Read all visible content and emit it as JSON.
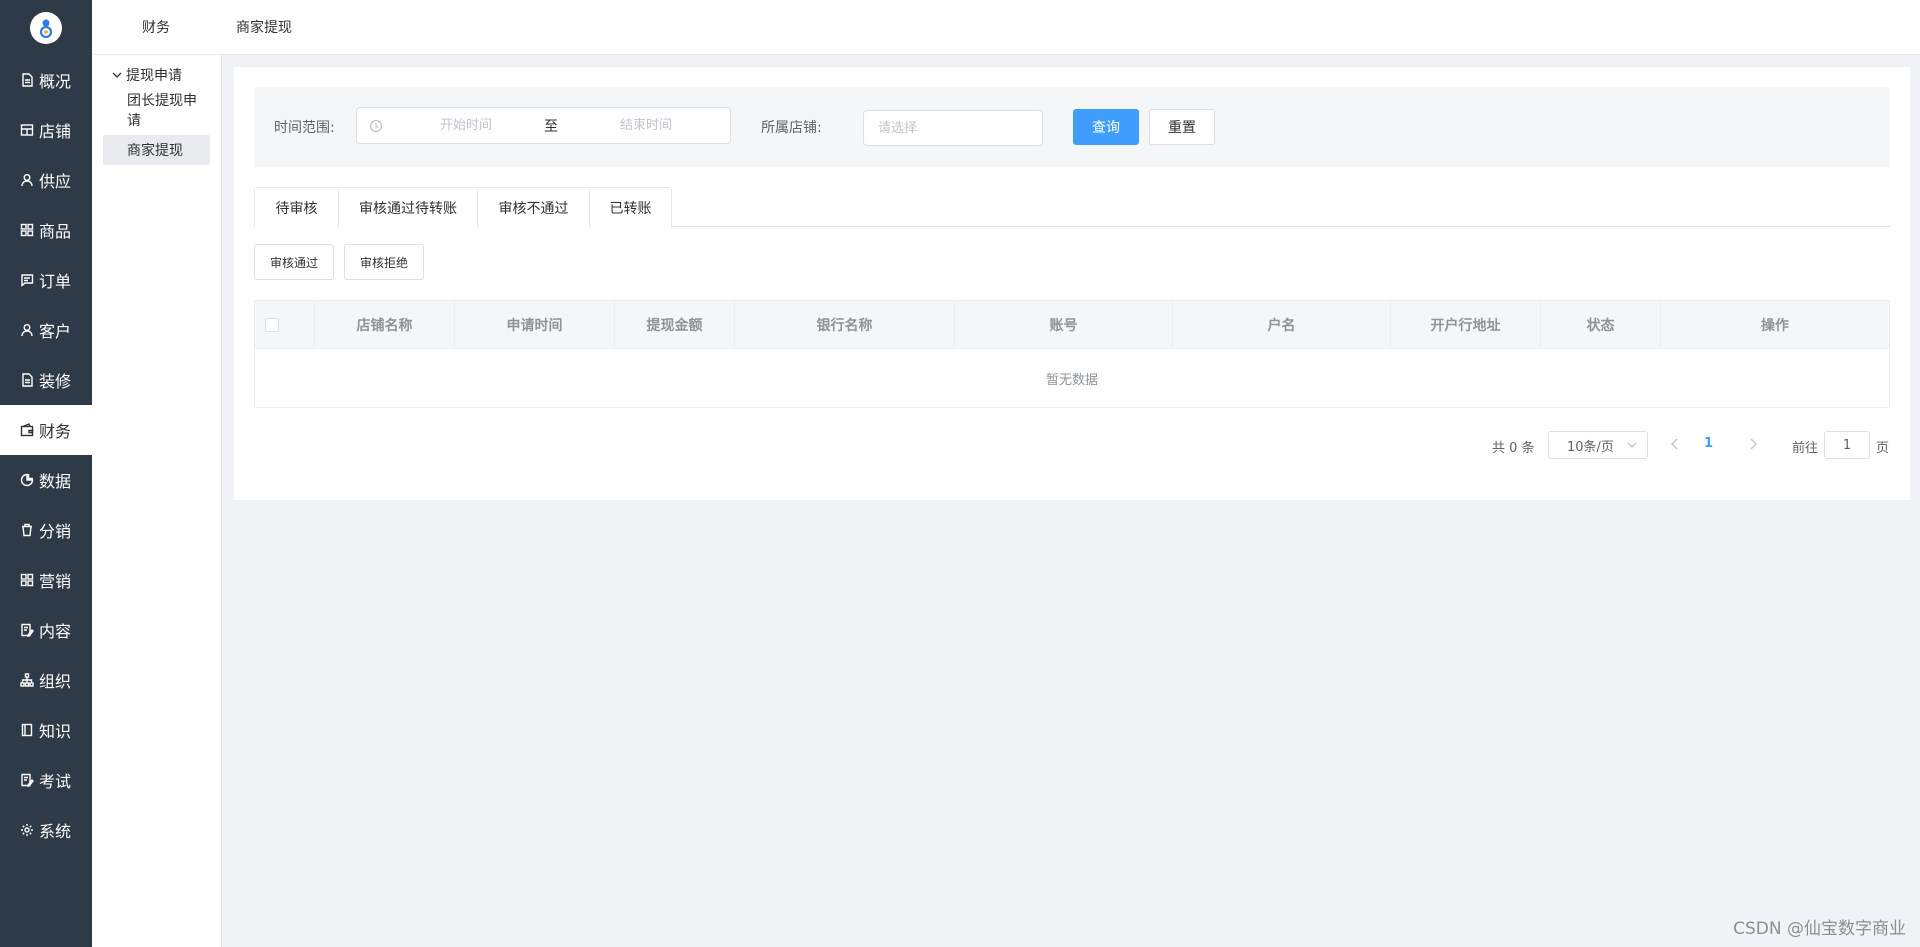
{
  "sidebar": {
    "items": [
      {
        "label": "概况",
        "icon": "document-icon"
      },
      {
        "label": "店铺",
        "icon": "store-icon"
      },
      {
        "label": "供应",
        "icon": "person-icon"
      },
      {
        "label": "商品",
        "icon": "grid-icon"
      },
      {
        "label": "订单",
        "icon": "message-icon"
      },
      {
        "label": "客户",
        "icon": "user-icon"
      },
      {
        "label": "装修",
        "icon": "file-icon"
      },
      {
        "label": "财务",
        "icon": "wallet-icon"
      },
      {
        "label": "数据",
        "icon": "chart-icon"
      },
      {
        "label": "分销",
        "icon": "trash-bag-icon"
      },
      {
        "label": "营销",
        "icon": "grid-icon"
      },
      {
        "label": "内容",
        "icon": "edit-doc-icon"
      },
      {
        "label": "组织",
        "icon": "org-chart-icon"
      },
      {
        "label": "知识",
        "icon": "notebook-icon"
      },
      {
        "label": "考试",
        "icon": "exam-icon"
      },
      {
        "label": "系统",
        "icon": "gear-icon"
      }
    ],
    "active": "财务"
  },
  "topbar": {
    "tab1": "财务",
    "tab2": "商家提现"
  },
  "submenu": {
    "group": "提现申请",
    "item1": "团长提现申请",
    "item2": "商家提现"
  },
  "filter": {
    "time_label": "时间范围:",
    "start_placeholder": "开始时间",
    "separator": "至",
    "end_placeholder": "结束时间",
    "shop_label": "所属店铺:",
    "shop_placeholder": "请选择",
    "query": "查询",
    "reset": "重置"
  },
  "tabs": [
    "待审核",
    "审核通过待转账",
    "审核不通过",
    "已转账"
  ],
  "actions": {
    "approve": "审核通过",
    "reject": "审核拒绝"
  },
  "table": {
    "columns": [
      "店铺名称",
      "申请时间",
      "提现金额",
      "银行名称",
      "账号",
      "户名",
      "开户行地址",
      "状态",
      "操作"
    ],
    "empty_text": "暂无数据"
  },
  "pagination": {
    "total": "共 0 条",
    "page_size": "10条/页",
    "current_page": "1",
    "goto_label": "前往",
    "goto_value": "1",
    "page_suffix": "页"
  },
  "watermark": "CSDN @仙宝数字商业",
  "colors": {
    "sidebar_bg": "#2e3a47",
    "primary": "#409eff"
  }
}
